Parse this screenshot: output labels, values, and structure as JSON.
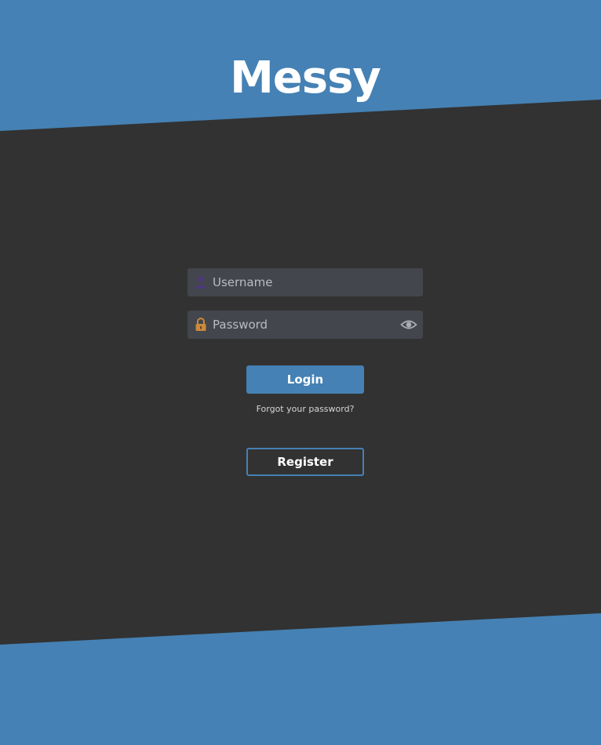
{
  "app": {
    "title": "Messy"
  },
  "login_form": {
    "username": {
      "placeholder": "Username",
      "value": "",
      "icon": "user-icon"
    },
    "password": {
      "placeholder": "Password",
      "value": "",
      "icon": "lock-icon",
      "toggle_icon": "eye-icon"
    },
    "login_label": "Login",
    "forgot_label": "Forgot your password?",
    "register_label": "Register"
  },
  "colors": {
    "accent": "#4581b4",
    "background": "#323232",
    "field": "#43464c",
    "user_icon": "#4c3a78",
    "lock_icon": "#c98a3c"
  }
}
